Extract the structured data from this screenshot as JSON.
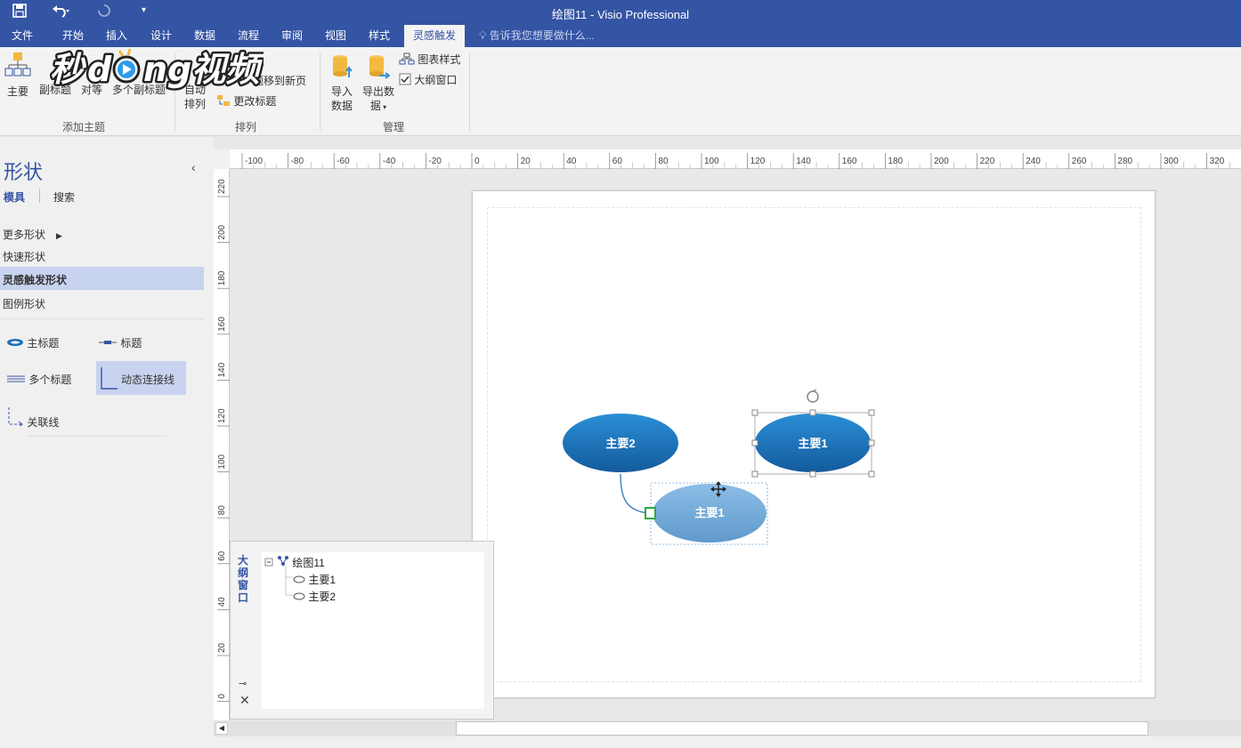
{
  "window": {
    "title": "绘图11 - Visio Professional"
  },
  "quick_access": {
    "save": "save-icon",
    "undo": "undo-icon",
    "redo": "redo-icon"
  },
  "ribbon_tabs": [
    "文件",
    "开始",
    "插入",
    "设计",
    "数据",
    "流程",
    "审阅",
    "视图",
    "样式",
    "灵感触发"
  ],
  "active_tab": "灵感触发",
  "tell_me": "告诉我您想要做什么...",
  "ribbon": {
    "add_topic": {
      "label": "添加主题",
      "buttons": [
        "主要",
        "副标题",
        "对等",
        "多个副标题"
      ]
    },
    "arrange": {
      "label": "排列",
      "auto_arrange": [
        "自动",
        "排列"
      ],
      "move_topic": "题移到新页",
      "change_topic": "更改标题"
    },
    "manage": {
      "label": "管理",
      "import": [
        "导入",
        "数据"
      ],
      "export": [
        "导出数",
        "据"
      ],
      "chart_style": "图表样式",
      "outline_window": "大纲窗口",
      "outline_checked": true
    }
  },
  "watermark": {
    "text_a": "秒",
    "text_b": "d",
    "text_c": "ng视频"
  },
  "shapes_panel": {
    "title": "形状",
    "tabs": [
      "模具",
      "搜索"
    ],
    "links": [
      "更多形状",
      "快速形状",
      "灵感触发形状",
      "图例形状"
    ],
    "active_stencil": "灵感触发形状",
    "masters": [
      "主标题",
      "标题",
      "多个标题",
      "动态连接线",
      "关联线"
    ]
  },
  "hruler_labels": [
    "-100",
    "-80",
    "-60",
    "-40",
    "-20",
    "0",
    "20",
    "40",
    "60",
    "80",
    "100",
    "120",
    "140",
    "160",
    "180",
    "200",
    "220",
    "240",
    "260",
    "280",
    "300",
    "320"
  ],
  "vruler_labels": [
    "220",
    "200",
    "180",
    "160",
    "140",
    "120",
    "100",
    "80",
    "60",
    "40",
    "20",
    "0"
  ],
  "diagram": {
    "shapes": [
      {
        "label": "主要2",
        "color": "#1f6fb5"
      },
      {
        "label": "主要1",
        "color": "#1f6fb5",
        "selected": true
      },
      {
        "label": "主要1",
        "color": "#6fa6d6",
        "dragging": true
      }
    ],
    "accent": "#3454a4"
  },
  "outline": {
    "tab_label": "大纲窗口",
    "root": "绘图11",
    "children": [
      "主要1",
      "主要2"
    ]
  }
}
